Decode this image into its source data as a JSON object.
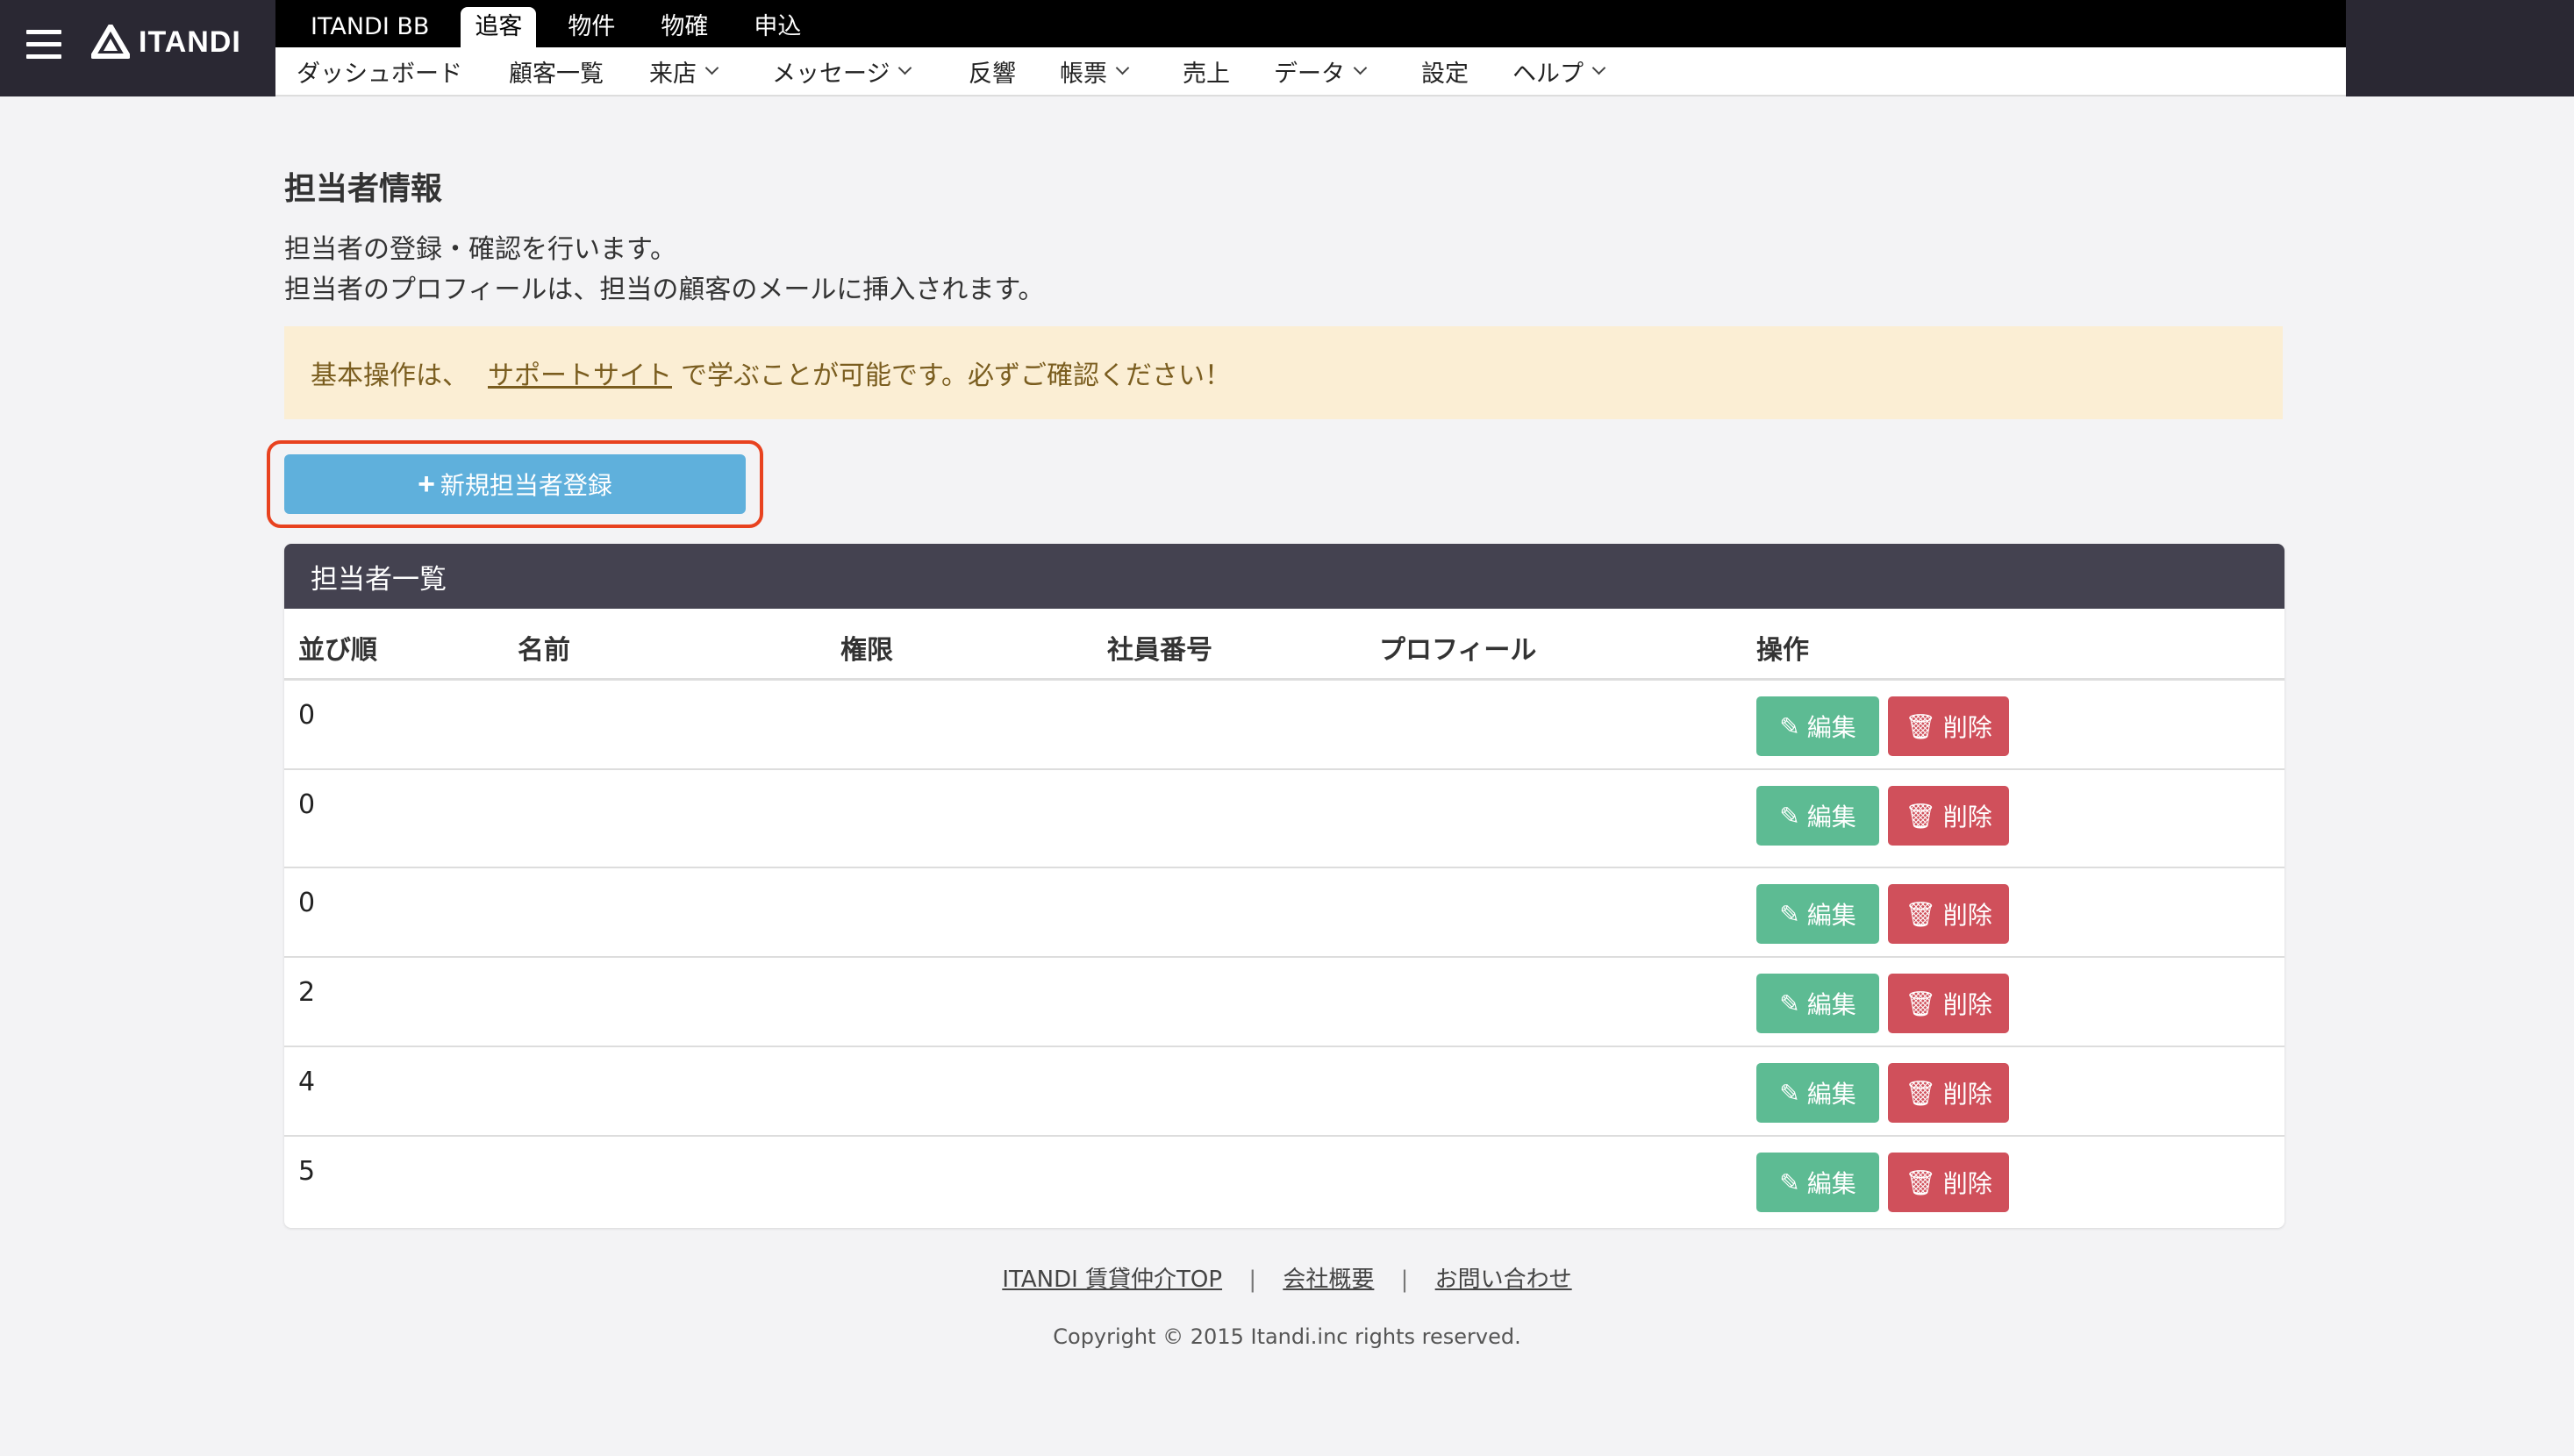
{
  "brand": {
    "name": "ITANDI"
  },
  "top_tabs": [
    {
      "label": "ITANDI BB"
    },
    {
      "label": "追客"
    },
    {
      "label": "物件"
    },
    {
      "label": "物確"
    },
    {
      "label": "申込"
    }
  ],
  "sub_nav": [
    {
      "label": "ダッシュボード"
    },
    {
      "label": "顧客一覧"
    },
    {
      "label": "来店"
    },
    {
      "label": "メッセージ"
    },
    {
      "label": "反響"
    },
    {
      "label": "帳票"
    },
    {
      "label": "売上"
    },
    {
      "label": "データ"
    },
    {
      "label": "設定"
    },
    {
      "label": "ヘルプ"
    }
  ],
  "page": {
    "title": "担当者情報",
    "desc_line1": "担当者の登録・確認を行います。",
    "desc_line2": "担当者のプロフィールは、担当の顧客のメールに挿入されます。",
    "notice_prefix": "基本操作は、",
    "notice_link": "サポートサイト",
    "notice_suffix": "で学ぶことが可能です。必ずご確認ください！",
    "new_button": "新規担当者登録"
  },
  "table": {
    "title": "担当者一覧",
    "columns": [
      "並び順",
      "名前",
      "権限",
      "社員番号",
      "プロフィール",
      "操作"
    ],
    "rows": [
      {
        "order": "0"
      },
      {
        "order": "0"
      },
      {
        "order": "0"
      },
      {
        "order": "2"
      },
      {
        "order": "4"
      },
      {
        "order": "5"
      }
    ],
    "edit_label": "編集",
    "delete_label": "削除"
  },
  "footer": {
    "link1": "ITANDI 賃貸仲介TOP",
    "link2": "会社概要",
    "link3": "お問い合わせ",
    "separator": "|",
    "copyright": "Copyright © 2015 Itandi.inc rights reserved."
  },
  "colors": {
    "header_dark": "#2a2833",
    "primary_button": "#5fb0dc",
    "edit_button": "#5dbb93",
    "delete_button": "#d0505b",
    "notice_bg": "#fbeed4",
    "highlight": "#e8421f"
  }
}
